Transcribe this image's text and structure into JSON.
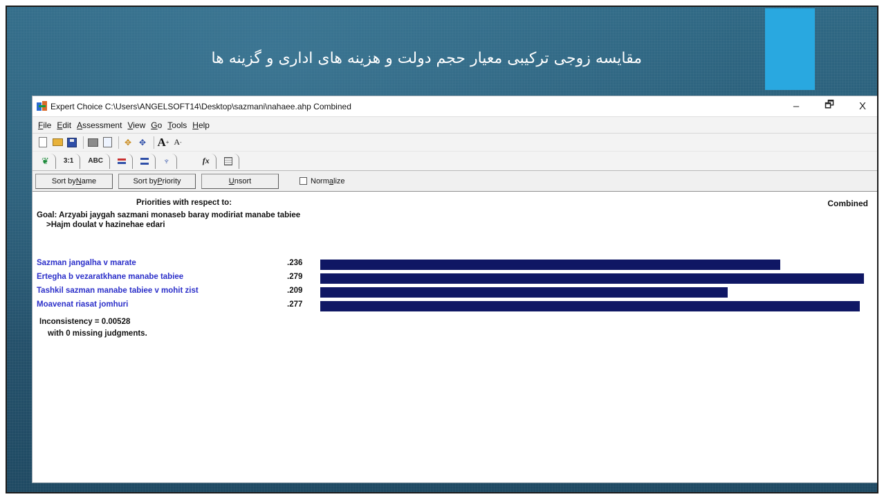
{
  "slide": {
    "title": "مقایسه زوجی ترکیبی معیار حجم دولت و هزینه های اداری و گزینه ها",
    "accent_color": "#29a8e0"
  },
  "window": {
    "title": "Expert Choice   C:\\Users\\ANGELSOFT14\\Desktop\\sazmani\\nahaee.ahp   Combined",
    "controls": {
      "minimize": "–",
      "restore": "🗗",
      "close": "X"
    }
  },
  "menu": [
    {
      "u": "F",
      "rest": "ile"
    },
    {
      "u": "E",
      "rest": "dit"
    },
    {
      "u": "A",
      "rest": "ssessment"
    },
    {
      "u": "V",
      "rest": "iew"
    },
    {
      "u": "G",
      "rest": "o"
    },
    {
      "u": "T",
      "rest": "ools"
    },
    {
      "u": "H",
      "rest": "elp"
    }
  ],
  "tabs": {
    "pairwise": "3:1",
    "verbal": "ABC"
  },
  "buttons": {
    "sort_name_pre": "Sort by ",
    "sort_name_u": "N",
    "sort_name_post": "ame",
    "sort_priority_pre": "Sort by ",
    "sort_priority_u": "P",
    "sort_priority_post": "riority",
    "unsort_u": "U",
    "unsort_post": "nsort",
    "normalize_pre": "Norm",
    "normalize_u": "a",
    "normalize_post": "lize"
  },
  "content": {
    "heading": "Priorities with respect to:",
    "mode": "Combined",
    "goal": "Goal: Arzyabi jaygah sazmani monaseb baray modiriat manabe tabiee",
    "criterion": ">Hajm doulat v hazinehae edari",
    "inconsistency": "Inconsistency = 0.00528",
    "missing": "with 0  missing judgments."
  },
  "chart_data": {
    "type": "bar",
    "categories": [
      "Sazman jangalha v marate",
      "Ertegha b vezaratkhane manabe tabiee",
      "Tashkil sazman manabe tabiee v mohit zist",
      "Moavenat riasat jomhuri"
    ],
    "labels": [
      ".236",
      ".279",
      ".209",
      ".277"
    ],
    "values": [
      0.236,
      0.279,
      0.209,
      0.277
    ],
    "bar_color": "#0f1764",
    "label_color": "#2b2fc9"
  }
}
